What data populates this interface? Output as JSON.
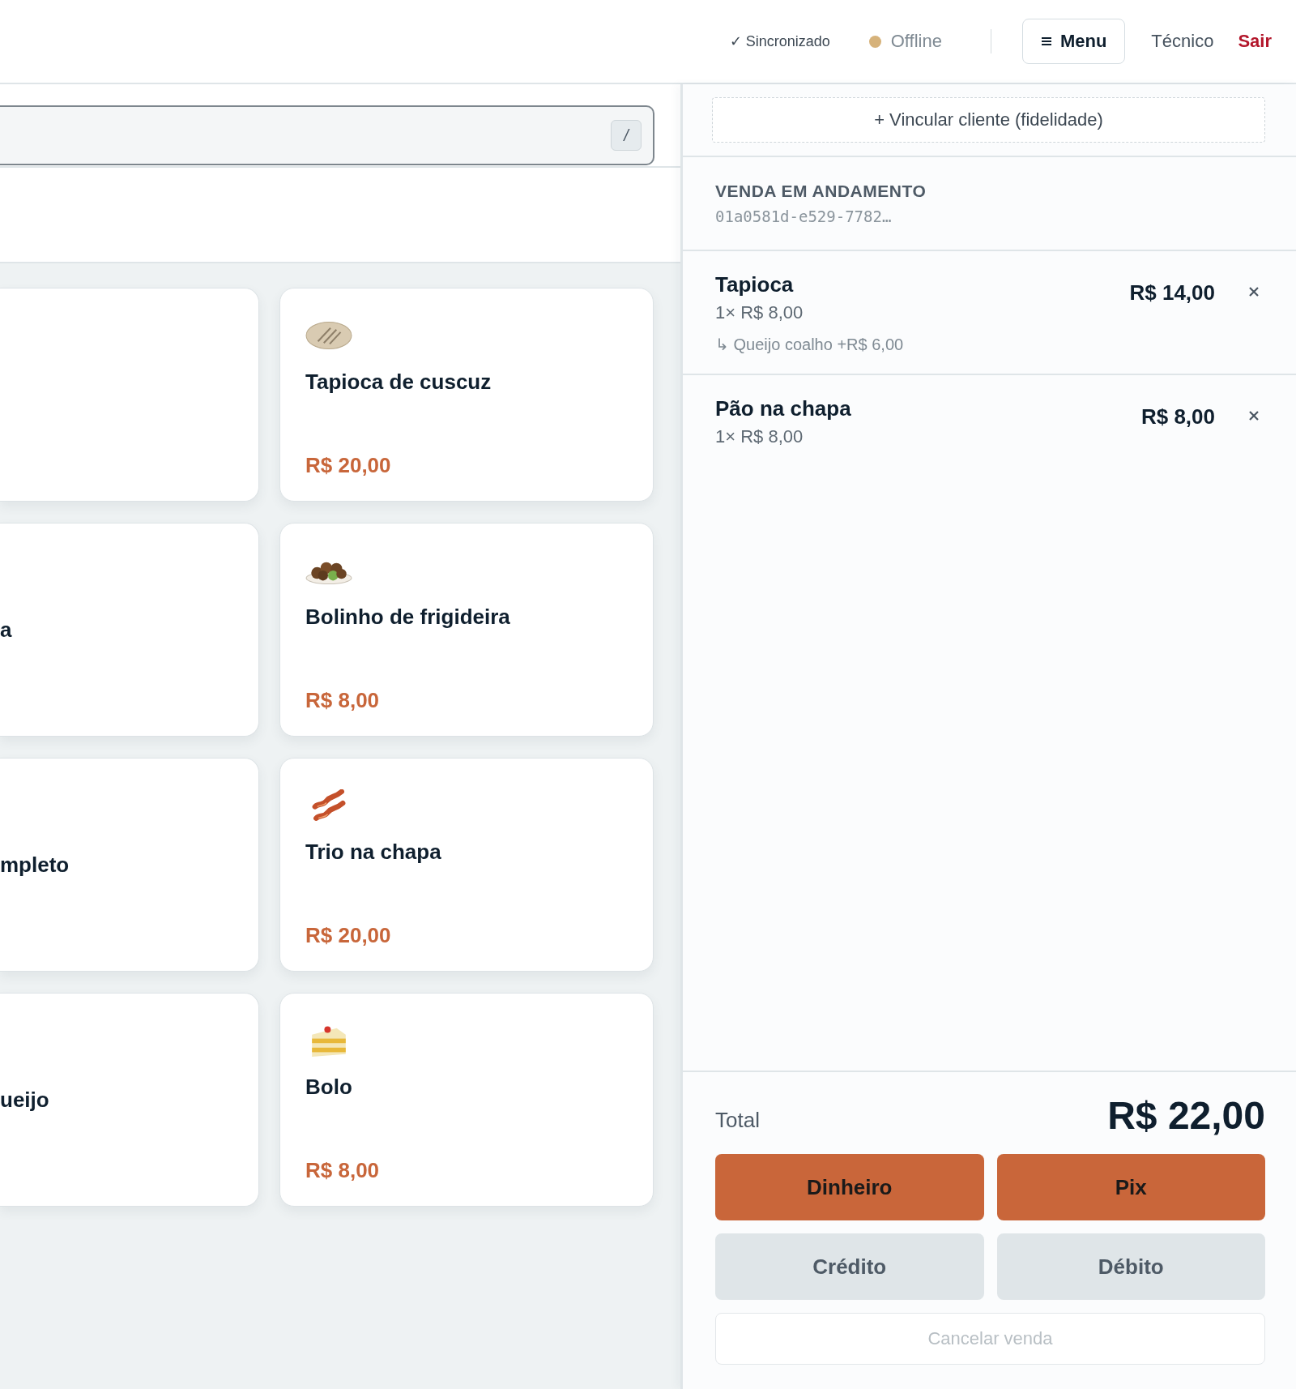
{
  "header": {
    "sync": "✓ Sincronizado",
    "connection": {
      "label": "Offline",
      "color": "#d6b27a"
    },
    "menu_button": "Menu",
    "tecnico": "Técnico",
    "logout": "Sair"
  },
  "search": {
    "shortcut": "/"
  },
  "products": [
    {
      "kind": "clipped"
    },
    {
      "kind": "full",
      "name": "Tapioca de cuscuz",
      "price": "R$ 20,00"
    },
    {
      "kind": "clipped",
      "name": "a"
    },
    {
      "kind": "full",
      "name": "Bolinho de frigideira",
      "price": "R$ 8,00"
    },
    {
      "kind": "clipped",
      "name": "mpleto"
    },
    {
      "kind": "full",
      "name": "Trio na chapa",
      "price": "R$ 20,00"
    },
    {
      "kind": "clipped",
      "name": "ueijo"
    },
    {
      "kind": "full",
      "name": "Bolo",
      "price": "R$ 8,00"
    }
  ],
  "cart": {
    "link_customer": "+ Vincular cliente (fidelidade)",
    "sale": {
      "title": "VENDA EM ANDAMENTO",
      "id": "01a0581d-e529-7782…"
    },
    "items": [
      {
        "name": "Tapioca",
        "qty_price": "1× R$ 8,00",
        "addon": "↳ Queijo coalho +R$ 6,00",
        "total": "R$ 14,00"
      },
      {
        "name": "Pão na chapa",
        "qty_price": "1× R$ 8,00",
        "total": "R$ 8,00"
      }
    ],
    "total_label": "Total",
    "total_value": "R$ 22,00",
    "payments": [
      {
        "label": "Dinheiro",
        "kind": "primary"
      },
      {
        "label": "Pix",
        "kind": "primary"
      },
      {
        "label": "Crédito",
        "kind": "secondary"
      },
      {
        "label": "Débito",
        "kind": "secondary"
      }
    ],
    "cancel": {
      "label": "Cancelar venda",
      "disabled": true
    }
  }
}
